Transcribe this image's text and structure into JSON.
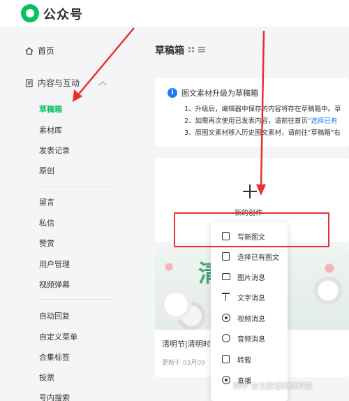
{
  "app": {
    "title": "公众号"
  },
  "sidebar": {
    "home": "首页",
    "content_section": "内容与互动",
    "items_group1": [
      "草稿箱",
      "素材库",
      "发表记录",
      "原创"
    ],
    "items_group2": [
      "留言",
      "私信",
      "赞赏",
      "用户管理",
      "视频弹幕"
    ],
    "items_group3": [
      "自动回复",
      "自定义菜单",
      "合集标签",
      "投票",
      "号内搜索"
    ],
    "active_item": "草稿箱"
  },
  "main": {
    "page_title": "草稿箱",
    "notice": {
      "title": "图文素材升级为草稿箱",
      "line1": "1、升级后，编辑器中保存的内容将存在草稿箱中。草",
      "line2_prefix": "2、如需再次使用已发表内容，请前往首页",
      "line2_link": "\"选择已有",
      "line3": "3、原图文素材移入历史图文素材，请前往\"草稿箱\"右"
    },
    "create_label": "新的创作",
    "article": {
      "cover_text": "清",
      "title": "清明节|清明时",
      "meta": "更新于 03月09"
    }
  },
  "dropdown": {
    "items": [
      {
        "label": "写新图文",
        "icon": "doc-icon"
      },
      {
        "label": "选择已有图文",
        "icon": "doc-select-icon"
      },
      {
        "label": "图片消息",
        "icon": "image-icon"
      },
      {
        "label": "文字消息",
        "icon": "text-icon"
      },
      {
        "label": "视频消息",
        "icon": "video-icon"
      },
      {
        "label": "音频消息",
        "icon": "audio-icon"
      },
      {
        "label": "转载",
        "icon": "repost-icon"
      },
      {
        "label": "直播",
        "icon": "live-icon"
      }
    ]
  },
  "watermark": "知乎 @主舵者网络科技",
  "colors": {
    "accent": "#07c160",
    "annotation": "#e8312d",
    "link": "#1e7cf3"
  }
}
